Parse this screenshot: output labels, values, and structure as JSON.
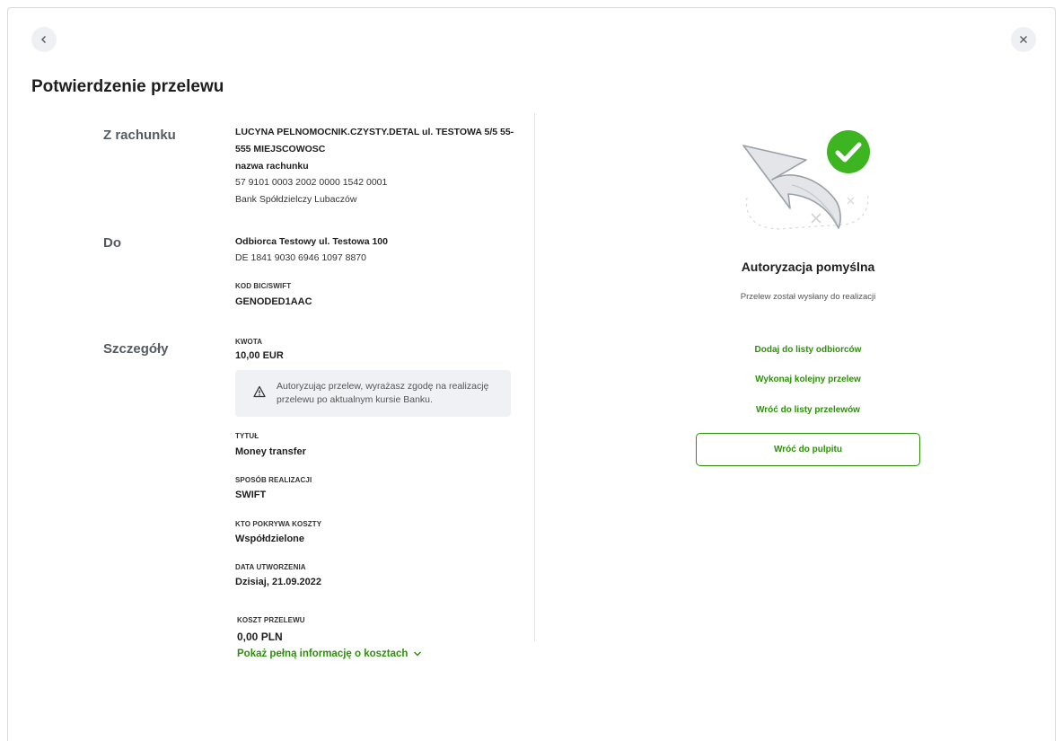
{
  "header": {
    "title": "Potwierdzenie przelewu",
    "back_icon": "chevron-left-icon",
    "close_icon": "close-icon"
  },
  "from": {
    "label": "Z rachunku",
    "owner_line1": "LUCYNA PELNOMOCNIK.CZYSTY.DETAL ul. TESTOWA 5/5 55-",
    "owner_line2": "555 MIEJSCOWOSC",
    "account_name": "nazwa rachunku",
    "account_number": "57 9101 0003 2002 0000 1542 0001",
    "bank": "Bank Spółdzielczy Lubaczów"
  },
  "to": {
    "label": "Do",
    "recipient": "Odbiorca Testowy ul. Testowa 100",
    "iban": "DE 1841 9030 6946 1097 8870",
    "bic_label": "KOD BIC/SWIFT",
    "bic_value": "GENODED1AAC"
  },
  "details": {
    "label": "Szczegóły",
    "amount_label": "KWOTA",
    "amount_value": "10,00 EUR",
    "notice_icon": "warning-icon",
    "notice_line1": "Autoryzując przelew, wyrażasz zgodę na realizację",
    "notice_line2": "przelewu po aktualnym kursie Banku.",
    "title_label": "TYTUŁ",
    "title_value": "Money transfer",
    "method_label": "SPOSÓB REALIZACJI",
    "method_value": "SWIFT",
    "costs_label": "KTO POKRYWA KOSZTY",
    "costs_value": "Współdzielone",
    "created_label": "DATA UTWORZENIA",
    "created_value": "Dzisiaj, 21.09.2022",
    "fee_label": "KOSZT PRZELEWU",
    "fee_value": "0,00 PLN",
    "show_more": "Pokaż pełną informację o kosztach",
    "show_more_icon": "chevron-down-icon"
  },
  "result": {
    "illustration": "success-arrow-illustration",
    "check_icon": "check-circle-icon",
    "title": "Autoryzacja pomyślna",
    "subtitle": "Przelew został wysłany do realizacji",
    "link_add_recipient": "Dodaj do listy odbiorców",
    "link_new_transfer": "Wykonaj kolejny przelew",
    "link_back_list": "Wróć do listy przelewów",
    "button_dashboard": "Wróć do pulpitu"
  },
  "colors": {
    "accent": "#2f8f0c",
    "check": "#3cb521",
    "notice_bg": "#f0f1f5"
  }
}
